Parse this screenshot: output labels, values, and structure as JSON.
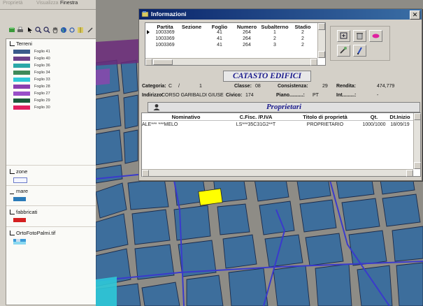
{
  "menubar": {
    "items": [
      "Proprietà",
      "Visualizza",
      "Finestra"
    ]
  },
  "legend": {
    "terreni": {
      "label": "Terreni",
      "checked": true,
      "items": [
        {
          "label": "Foglio 41",
          "color": "#3a5a8a"
        },
        {
          "label": "Foglio 40",
          "color": "#6b3f8a"
        },
        {
          "label": "Foglio 36",
          "color": "#2aa8a8"
        },
        {
          "label": "Foglio 34",
          "color": "#3f8a5a"
        },
        {
          "label": "Foglio 33",
          "color": "#2ec8d8"
        },
        {
          "label": "Foglio 28",
          "color": "#8a3fb0"
        },
        {
          "label": "Foglio 27",
          "color": "#9a4fc8"
        },
        {
          "label": "Foglio 29",
          "color": "#1a5a3a"
        },
        {
          "label": "Foglio 30",
          "color": "#e02060"
        }
      ]
    },
    "zone": {
      "label": "zone",
      "checked": true,
      "color": "#f4f6ff"
    },
    "mare": {
      "label": "mare",
      "checked": false,
      "color": "#2a7ab8"
    },
    "fabbricati": {
      "label": "fabbricati",
      "checked": true,
      "color": "#d42020"
    },
    "ortofoto": {
      "label": "OrtoFotoPalmi.tif",
      "checked": true
    }
  },
  "window": {
    "title": "Informazioni",
    "grid1": {
      "headers": [
        "Partita",
        "Sezione",
        "Foglio",
        "Numero",
        "Subalterno",
        "Stadio"
      ],
      "rows": [
        [
          "1003369",
          "",
          "41",
          "264",
          "1",
          "2"
        ],
        [
          "1003369",
          "",
          "41",
          "264",
          "2",
          "2"
        ],
        [
          "1003369",
          "",
          "41",
          "264",
          "3",
          "2"
        ]
      ]
    },
    "catasto_title": "CATASTO EDIFICI",
    "fields": {
      "categoria_label": "Categoria:",
      "categoria_value": "C",
      "categoria_sep": "/",
      "categoria_num": "1",
      "classe_label": "Classe:",
      "classe_value": "08",
      "consistenza_label": "Consistenza:",
      "consistenza_value": "29",
      "rendita_label": "Rendita:",
      "rendita_value": "474,779",
      "indirizzo_label": "Indirizzo:",
      "indirizzo_value": "CORSO GARIBALDI GIUSE",
      "civico_label": "Civico:",
      "civico_value": "174",
      "piano_label": "Piano..........:",
      "piano_value": "PT",
      "int_label": "Int.........:",
      "int_value": "-"
    },
    "proprietari_title": "Proprietari",
    "grid2": {
      "headers": [
        "Nominativo",
        "C.Fisc. /P.IVA",
        "Titolo di proprietà",
        "Qt.",
        "Dt.Inizio"
      ],
      "rows": [
        [
          "ALE*** ***MELO",
          "LS***35C31G2**T",
          "PROPRIETARIO",
          "1000/1000",
          "18/09/19"
        ]
      ]
    }
  }
}
